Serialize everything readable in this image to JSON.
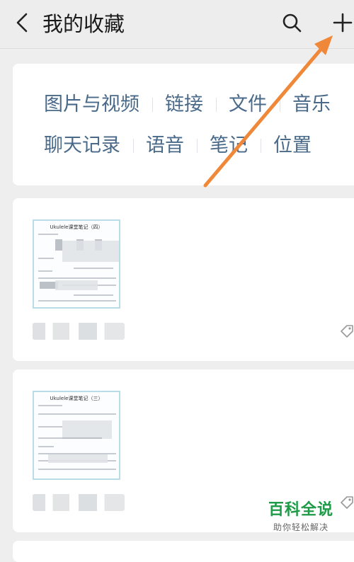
{
  "header": {
    "title": "我的收藏",
    "back_icon": "chevron-left-icon",
    "search_icon": "search-icon",
    "add_icon": "plus-icon"
  },
  "filters": {
    "row1": [
      "图片与视频",
      "链接",
      "文件",
      "音乐"
    ],
    "row2": [
      "聊天记录",
      "语音",
      "笔记",
      "位置"
    ]
  },
  "favorites": [
    {
      "doc_title": "Ukulele课堂笔记（四）",
      "tag_icon": "tag-icon"
    },
    {
      "doc_title": "Ukulele课堂笔记（三）",
      "tag_icon": "tag-icon"
    }
  ],
  "annotation": {
    "arrow_color": "#f0883a"
  },
  "watermark": {
    "main": "百科全说",
    "sub": "助你轻松解决",
    "color": "#1d9b46"
  }
}
